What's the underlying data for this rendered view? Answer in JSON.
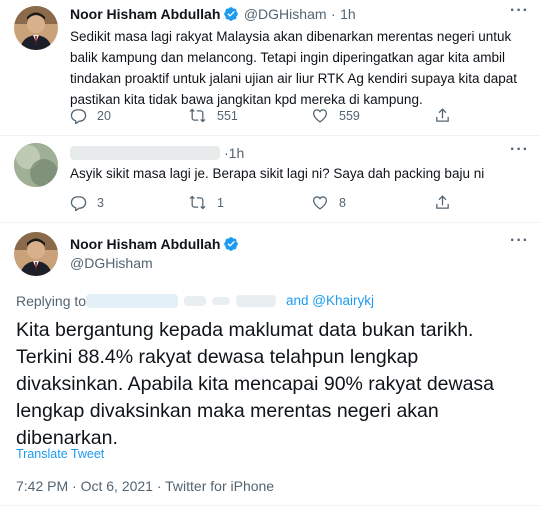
{
  "tweet1": {
    "display_name": "Noor Hisham Abdullah",
    "handle": "@DGHisham",
    "separator": "·",
    "time": "1h",
    "text": "Sedikit masa lagi rakyat Malaysia akan dibenarkan merentas negeri untuk balik kampung dan melancong. Tetapi ingin diperingatkan agar kita ambil tindakan proaktif untuk jalani ujian air liur RTK Ag kendiri supaya kita dapat pastikan kita tidak bawa jangkitan kpd mereka di kampung.",
    "replies": "20",
    "retweets": "551",
    "likes": "559"
  },
  "tweet2": {
    "separator": "·",
    "time": "1h",
    "text": "Asyik sikit masa lagi je. Berapa sikit lagi ni? Saya dah packing baju ni",
    "replies": "3",
    "retweets": "1",
    "likes": "8"
  },
  "main_tweet": {
    "display_name": "Noor Hisham Abdullah",
    "handle": "@DGHisham",
    "replying_to_label": "Replying to",
    "replying_to_and": "and @Khairykj",
    "text": "Kita bergantung kepada maklumat data bukan tarikh. Terkini 88.4% rakyat dewasa telahpun lengkap divaksinkan. Apabila kita mencapai 90% rakyat dewasa lengkap divaksinkan maka merentas negeri akan dibenarkan.",
    "translate_label": "Translate Tweet",
    "timestamp": "7:42 PM · Oct 6, 2021 · Twitter for iPhone"
  },
  "colors": {
    "accent": "#1d9bf0",
    "muted": "#536471",
    "text": "#0f1419"
  }
}
